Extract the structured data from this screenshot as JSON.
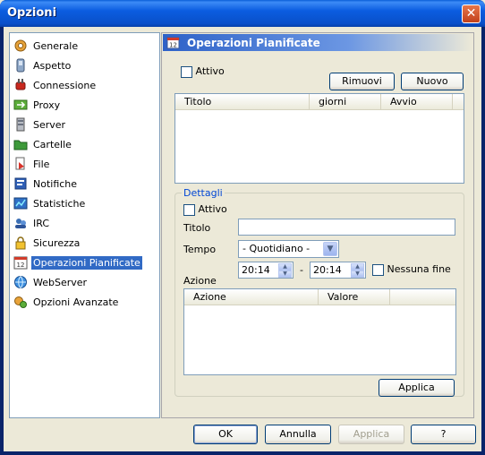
{
  "window": {
    "title": "Opzioni",
    "close_glyph": "✕"
  },
  "nav": {
    "items": [
      {
        "label": "Generale",
        "icon": "gear-icon"
      },
      {
        "label": "Aspetto",
        "icon": "appearance-icon"
      },
      {
        "label": "Connessione",
        "icon": "plug-icon"
      },
      {
        "label": "Proxy",
        "icon": "proxy-icon"
      },
      {
        "label": "Server",
        "icon": "server-icon"
      },
      {
        "label": "Cartelle",
        "icon": "folder-icon"
      },
      {
        "label": "File",
        "icon": "file-icon"
      },
      {
        "label": "Notifiche",
        "icon": "notification-icon"
      },
      {
        "label": "Statistiche",
        "icon": "statistics-icon"
      },
      {
        "label": "IRC",
        "icon": "irc-icon"
      },
      {
        "label": "Sicurezza",
        "icon": "lock-icon"
      },
      {
        "label": "Operazioni Pianificate",
        "icon": "calendar-icon",
        "selected": true
      },
      {
        "label": "WebServer",
        "icon": "globe-icon"
      },
      {
        "label": "Opzioni Avanzate",
        "icon": "advanced-icon"
      }
    ]
  },
  "panel": {
    "title": "Operazioni Pianificate",
    "active_label": "Attivo",
    "remove_label": "Rimuovi",
    "new_label": "Nuovo",
    "tasks_columns": [
      "Titolo",
      "giorni",
      "Avvio"
    ],
    "details": {
      "legend": "Dettagli",
      "active_label": "Attivo",
      "title_label": "Titolo",
      "title_value": "",
      "time_label": "Tempo",
      "time_value": "- Quotidiano -",
      "start_time": "20:14",
      "separator": "-",
      "end_time": "20:14",
      "no_end_label": "Nessuna fine",
      "action_label": "Azione",
      "actions_columns": [
        "Azione",
        "Valore"
      ],
      "apply_label": "Applica"
    }
  },
  "footer": {
    "ok_label": "OK",
    "cancel_label": "Annulla",
    "apply_label": "Applica",
    "help_label": "?"
  }
}
